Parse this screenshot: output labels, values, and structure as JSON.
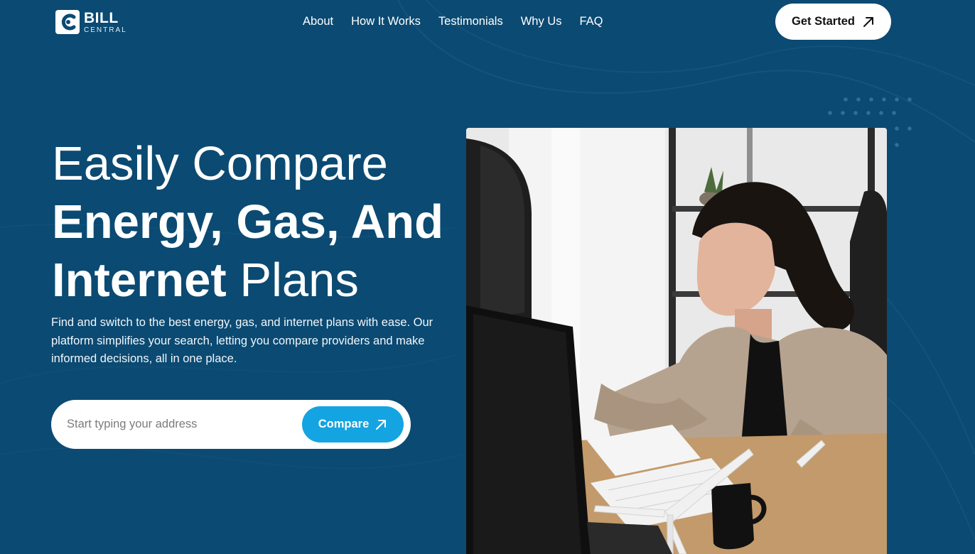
{
  "brand": {
    "name_line1": "BILL",
    "name_line2": "CENTRAL"
  },
  "nav": {
    "items": [
      "About",
      "How It Works",
      "Testimonials",
      "Why Us",
      "FAQ"
    ]
  },
  "header": {
    "cta_label": "Get Started",
    "cta_icon": "arrow-up-right-icon"
  },
  "hero": {
    "title_line1": "Easily Compare",
    "title_line2": "Energy, Gas, And",
    "title_line3_bold": "Internet",
    "title_line3_light": "Plans",
    "description": "Find and switch to the best energy, gas, and internet plans with ease. Our platform simplifies your search, letting you compare providers and make informed decisions, all in one place."
  },
  "search": {
    "value": "",
    "placeholder": "Start typing your address",
    "button_label": "Compare",
    "button_icon": "arrow-up-right-icon"
  },
  "colors": {
    "background": "#0b4a72",
    "accent": "#14a4e2",
    "button_light": "#ffffff"
  }
}
